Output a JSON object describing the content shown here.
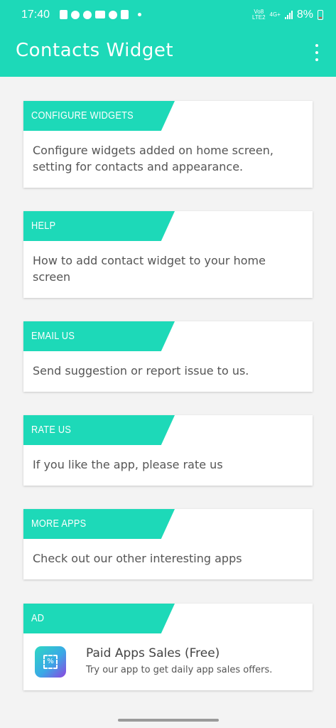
{
  "status_bar": {
    "time": "17:40",
    "network_top": "Vo8",
    "network_bottom": "LTE2",
    "net_type": "4G+",
    "battery": "8%"
  },
  "appbar": {
    "title": "Contacts Widget"
  },
  "cards": [
    {
      "header": "CONFIGURE WIDGETS",
      "description": "Configure widgets added on home screen, setting for contacts and appearance."
    },
    {
      "header": "HELP",
      "description": "How to add contact widget to your home screen"
    },
    {
      "header": "EMAIL US",
      "description": "Send suggestion or report issue to us."
    },
    {
      "header": "RATE US",
      "description": "If you like the app, please rate us"
    },
    {
      "header": "MORE APPS",
      "description": "Check out our other interesting apps"
    }
  ],
  "ad": {
    "header": "AD",
    "icon_glyph": "%",
    "title": "Paid Apps Sales (Free)",
    "subtitle": "Try our app to get daily app sales offers."
  },
  "colors": {
    "accent": "#1dd9b8",
    "background": "#f3f3f3",
    "text": "#555555"
  }
}
